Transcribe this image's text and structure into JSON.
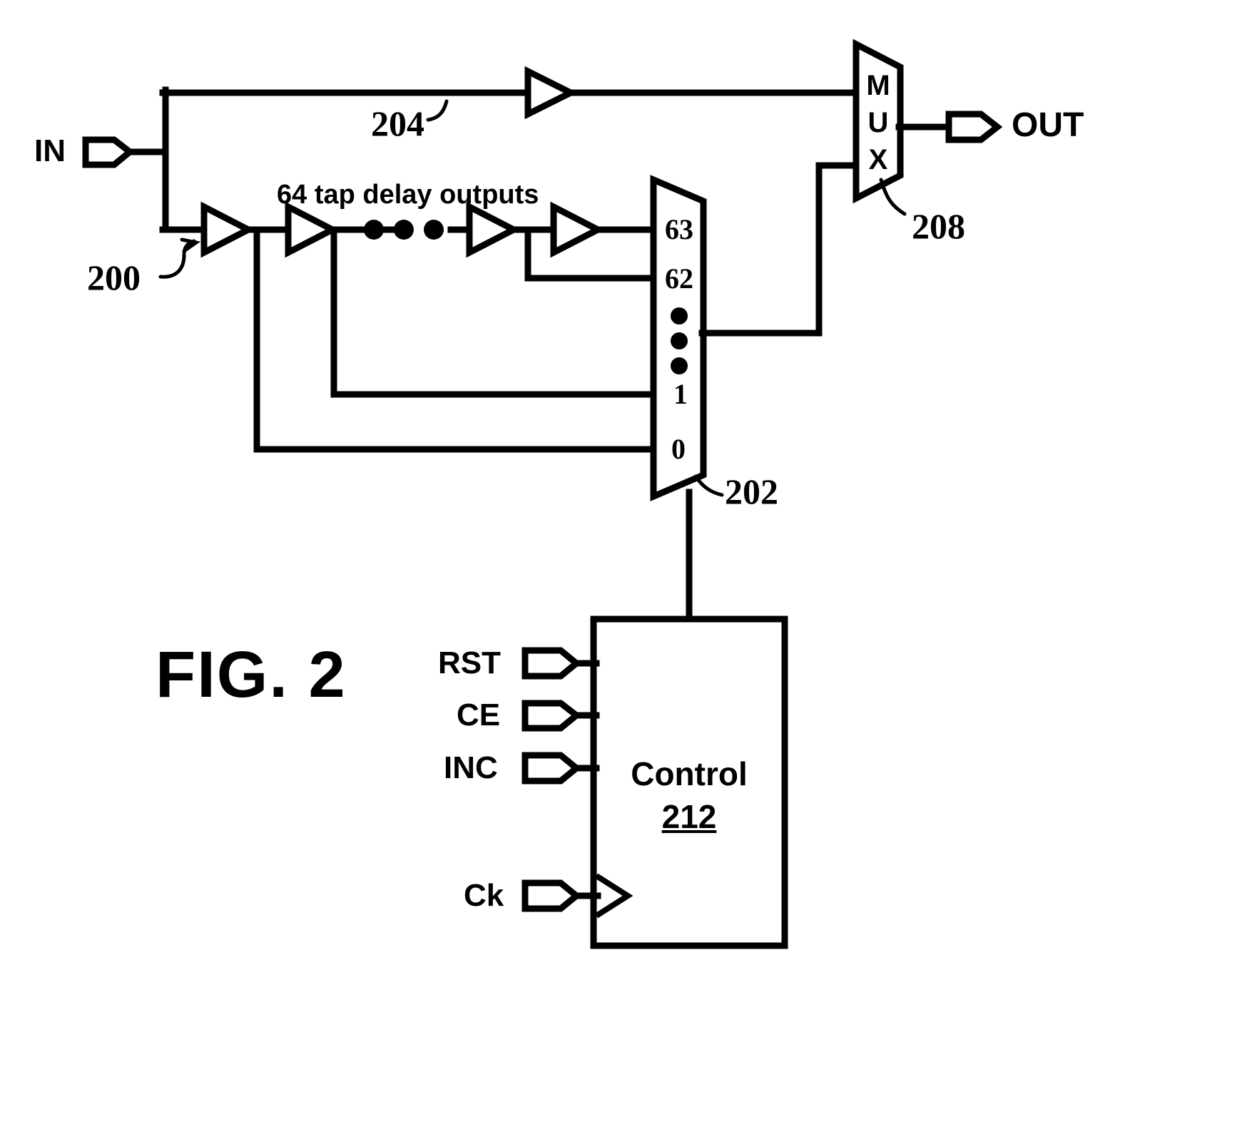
{
  "figure": {
    "caption": "FIG. 2",
    "title": "Programmable delay line with 64-tap delay chain, bypass path, output multiplexer and control block"
  },
  "ports": {
    "input": {
      "label": "IN",
      "name": "input-port"
    },
    "output": {
      "label": "OUT",
      "name": "output-port"
    },
    "reset": {
      "label": "RST"
    },
    "clock_enable": {
      "label": "CE"
    },
    "increment": {
      "label": "INC"
    },
    "clock": {
      "label": "Ck"
    }
  },
  "annotations": {
    "tap_outputs": "64 tap delay outputs",
    "ellipsis": "• • •"
  },
  "reference_numerals": {
    "delay_line": "200",
    "tap_mux": "202",
    "bypass_path": "204",
    "output_mux": "208",
    "control": "212"
  },
  "blocks": {
    "tap_mux": {
      "name": "tap-select-mux",
      "reference": "202",
      "pins": [
        "63",
        "62",
        "1",
        "0"
      ],
      "vertical_dots": 3
    },
    "output_mux": {
      "name": "output-mux",
      "reference": "208",
      "letters": [
        "M",
        "U",
        "X"
      ]
    },
    "control": {
      "name": "control-block",
      "label": "Control",
      "reference": "212"
    }
  },
  "delay_line": {
    "name": "delay-buffer-chain",
    "reference": "200",
    "buffer_count_visible": 4,
    "total_taps": 64
  },
  "bypass": {
    "name": "bypass-buffer",
    "reference": "204"
  },
  "colors": {
    "ink": "#000000",
    "paper": "#ffffff"
  }
}
